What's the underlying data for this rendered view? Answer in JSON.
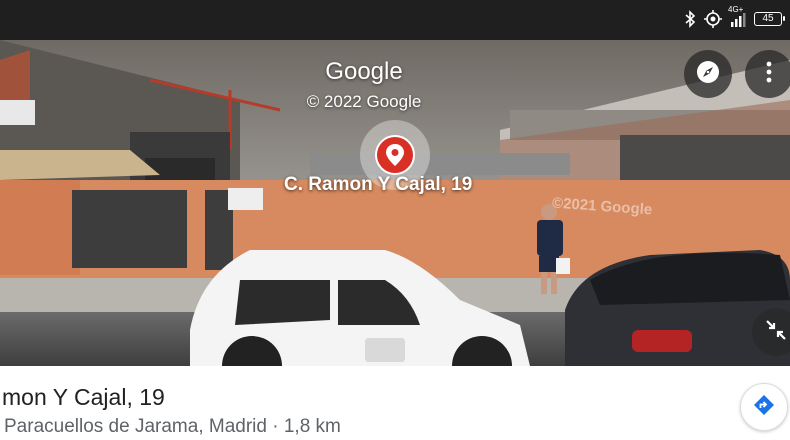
{
  "status_bar": {
    "network_label": "4G+",
    "battery_level": "45",
    "icons": [
      "bluetooth-icon",
      "location-icon",
      "signal-icon",
      "battery-icon"
    ]
  },
  "street_view": {
    "brand": "Google",
    "copyright": "© 2022 Google",
    "street_label": "C. Ramon Y Cajal, 19",
    "watermark": "©2021 Google",
    "icons": [
      "compass-icon",
      "more-vert-icon",
      "map-pin-icon",
      "collapse-icon"
    ]
  },
  "place": {
    "title": "mon Y Cajal, 19",
    "subtitle": "Paracuellos de Jarama, Madrid · 1,8 km"
  },
  "colors": {
    "pin": "#d93025",
    "directions_icon": "#1a73e8",
    "status_bar": "#1f1f1f"
  }
}
